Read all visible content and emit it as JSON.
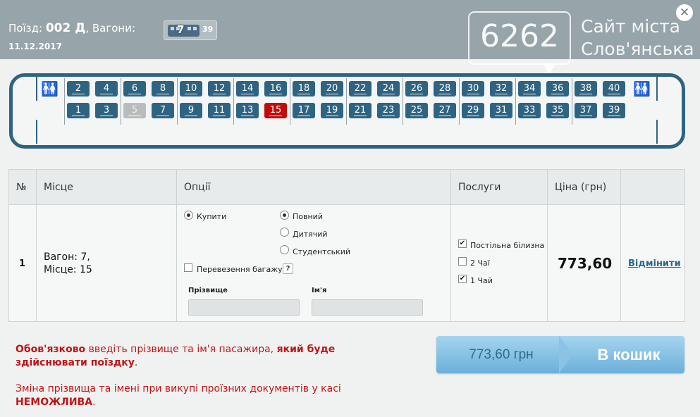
{
  "header": {
    "train_prefix": "Поїзд:",
    "train_number": "002 Д",
    "wagons_label": ", Вагони:",
    "wagon_number": "7",
    "wagon_free_seats": "39",
    "date": "11.12.2017",
    "close_icon": "close-icon"
  },
  "watermark": {
    "number": "6262",
    "line1": "Сайт міста",
    "line2": "Слов'янська"
  },
  "car": {
    "top_row": [
      "2",
      "4",
      "6",
      "8",
      "10",
      "12",
      "14",
      "16",
      "18",
      "20",
      "22",
      "24",
      "26",
      "28",
      "30",
      "32",
      "34",
      "36",
      "38",
      "40"
    ],
    "bottom_row": [
      "1",
      "3",
      "5",
      "7",
      "9",
      "11",
      "13",
      "15",
      "17",
      "19",
      "21",
      "23",
      "25",
      "27",
      "29",
      "31",
      "33",
      "35",
      "37",
      "39"
    ],
    "taken": [
      "5"
    ],
    "selected": [
      "15"
    ],
    "colors": {
      "seat": "#2e6482",
      "taken": "#b8bcbd",
      "selected": "#c40b0b"
    }
  },
  "table": {
    "headers": {
      "num": "№",
      "seat": "Місце",
      "options": "Опції",
      "services": "Послуги",
      "price": "Ціна (грн)"
    },
    "row": {
      "num": "1",
      "wagon": "Вагон: 7,",
      "place": "Місце: 15",
      "buy_label": "Купити",
      "full_label": "Повний",
      "child_label": "Дитячий",
      "student_label": "Студентський",
      "baggage_label": "Перевезення багажу",
      "help": "?",
      "surname_label": "Прізвище",
      "name_label": "Ім'я",
      "surname_value": "",
      "name_value": "",
      "service_linen": "Постільна білизна",
      "service_tea2": "2 Чаї",
      "service_tea1": "1 Чай",
      "price": "773,60",
      "cancel": "Відмінити"
    }
  },
  "notes": {
    "n1_a": "Обов'язково",
    "n1_b": " введіть прізвище та ім'я пасажира, ",
    "n1_c": "який буде здійснювати поїздку",
    "n1_d": ".",
    "n2_a": "Зміна прізвища та імені при викупі проїзних документів у касі ",
    "n2_b": "НЕМОЖЛИВА",
    "n2_c": "."
  },
  "buy": {
    "total": "773,60 грн",
    "cart": "В кошик"
  }
}
